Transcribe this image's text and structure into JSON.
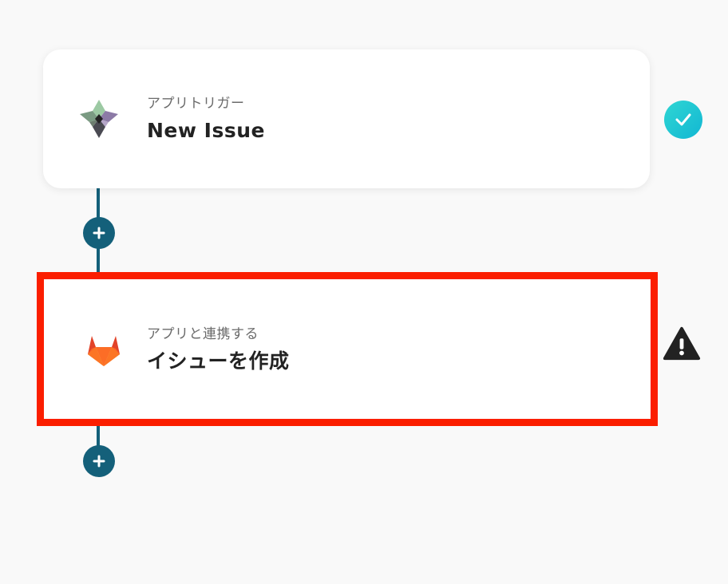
{
  "flow": {
    "steps": [
      {
        "subtitle": "アプリトリガー",
        "title": "New Issue",
        "icon": "trigger-app-icon",
        "status": "completed-check-icon"
      },
      {
        "subtitle": "アプリと連携する",
        "title": "イシューを作成",
        "icon": "gitlab-icon",
        "status": "warning-icon"
      }
    ],
    "add_step_icon": "plus-icon"
  },
  "colors": {
    "background": "#f9f9f9",
    "connector": "#14607a",
    "highlight_border": "#fb1e00",
    "check_badge": "#1ec4d3",
    "warning": "#222222"
  }
}
